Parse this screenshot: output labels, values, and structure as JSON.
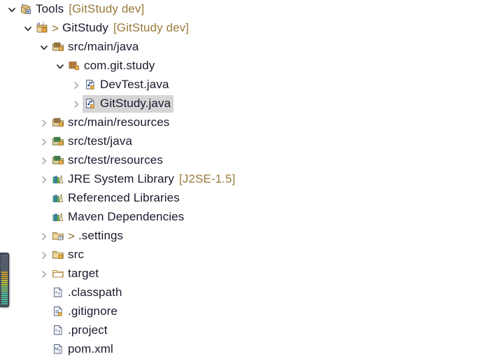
{
  "view": {
    "name": "project-explorer-tree",
    "background": "#ffffff",
    "selection_color": "#d6d6d6",
    "text_color": "#1a1a2e",
    "annotation_color": "#9b7a3a"
  },
  "tree": {
    "rows": [
      {
        "label": "Tools",
        "annotation": "[GitStudy dev]",
        "dirty_marker": "",
        "depth": 0,
        "twisty": "expanded",
        "icon": "working-set-icon",
        "selected": false
      },
      {
        "label": "GitStudy",
        "annotation": "[GitStudy dev]",
        "dirty_marker": ">",
        "depth": 1,
        "twisty": "expanded",
        "icon": "java-project-icon",
        "selected": false
      },
      {
        "label": "src/main/java",
        "annotation": "",
        "dirty_marker": "",
        "depth": 2,
        "twisty": "expanded",
        "icon": "source-folder-icon",
        "selected": false
      },
      {
        "label": "com.git.study",
        "annotation": "",
        "dirty_marker": "",
        "depth": 3,
        "twisty": "expanded",
        "icon": "package-icon",
        "selected": false
      },
      {
        "label": "DevTest.java",
        "annotation": "",
        "dirty_marker": "",
        "depth": 4,
        "twisty": "collapsed",
        "icon": "java-file-icon",
        "selected": false
      },
      {
        "label": "GitStudy.java",
        "annotation": "",
        "dirty_marker": "",
        "depth": 4,
        "twisty": "collapsed",
        "icon": "java-file-icon",
        "selected": true
      },
      {
        "label": "src/main/resources",
        "annotation": "",
        "dirty_marker": "",
        "depth": 2,
        "twisty": "collapsed",
        "icon": "source-folder-icon",
        "selected": false
      },
      {
        "label": "src/test/java",
        "annotation": "",
        "dirty_marker": "",
        "depth": 2,
        "twisty": "collapsed",
        "icon": "test-source-folder-icon",
        "selected": false
      },
      {
        "label": "src/test/resources",
        "annotation": "",
        "dirty_marker": "",
        "depth": 2,
        "twisty": "collapsed",
        "icon": "test-source-folder-icon",
        "selected": false
      },
      {
        "label": "JRE System Library",
        "annotation": "[J2SE-1.5]",
        "dirty_marker": "",
        "depth": 2,
        "twisty": "collapsed",
        "icon": "library-icon",
        "selected": false
      },
      {
        "label": "Referenced Libraries",
        "annotation": "",
        "dirty_marker": "",
        "depth": 2,
        "twisty": "none",
        "icon": "library-icon",
        "selected": false
      },
      {
        "label": "Maven Dependencies",
        "annotation": "",
        "dirty_marker": "",
        "depth": 2,
        "twisty": "none",
        "icon": "library-icon",
        "selected": false
      },
      {
        "label": ".settings",
        "annotation": "",
        "dirty_marker": ">",
        "depth": 2,
        "twisty": "collapsed",
        "icon": "folder-untracked-icon",
        "selected": false
      },
      {
        "label": "src",
        "annotation": "",
        "dirty_marker": "",
        "depth": 2,
        "twisty": "collapsed",
        "icon": "folder-tracked-icon",
        "selected": false
      },
      {
        "label": "target",
        "annotation": "",
        "dirty_marker": "",
        "depth": 2,
        "twisty": "collapsed",
        "icon": "folder-plain-icon",
        "selected": false
      },
      {
        "label": ".classpath",
        "annotation": "",
        "dirty_marker": "",
        "depth": 2,
        "twisty": "none",
        "icon": "xml-file-icon",
        "selected": false
      },
      {
        "label": ".gitignore",
        "annotation": "",
        "dirty_marker": "",
        "depth": 2,
        "twisty": "none",
        "icon": "text-file-icon",
        "selected": false
      },
      {
        "label": ".project",
        "annotation": "",
        "dirty_marker": "",
        "depth": 2,
        "twisty": "none",
        "icon": "xml-file-icon",
        "selected": false
      },
      {
        "label": "pom.xml",
        "annotation": "",
        "dirty_marker": "",
        "depth": 2,
        "twisty": "none",
        "icon": "maven-pom-icon",
        "selected": false
      }
    ]
  },
  "edge_meter": {
    "name": "edge-level-meter",
    "segment_colors": [
      "#5a6272",
      "#5a6272",
      "#5a6272",
      "#5a6272",
      "#5a6272",
      "#5a6272",
      "#5a6272",
      "#5a6272",
      "#c8a02a",
      "#c8a02a",
      "#c8a02a",
      "#c8a02a",
      "#b8c437",
      "#b8c437",
      "#b8c437",
      "#7ec46a",
      "#7ec46a",
      "#7ec46a",
      "#4fbd9a",
      "#4fbd9a",
      "#4fbd9a",
      "#4fbd9a",
      "#3fae96",
      "#3fae96"
    ]
  }
}
